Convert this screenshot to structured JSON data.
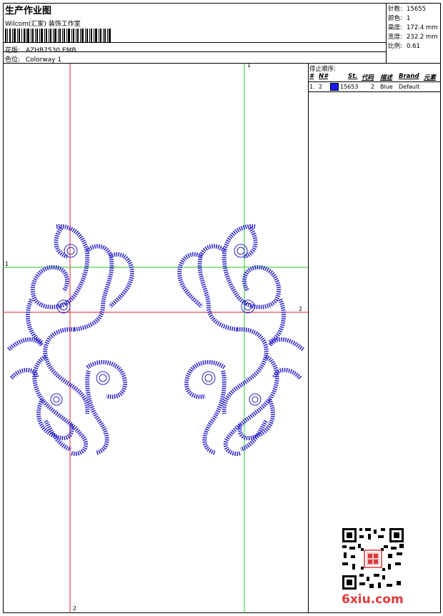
{
  "header": {
    "title": "生产作业图",
    "company": "Wilcom(汇家) 装饰工作室",
    "design_label": "花版:",
    "design_value": "AZHB7530.EMB",
    "colorway_label": "色位:",
    "colorway_value": "Colorway 1"
  },
  "stats": {
    "stitches_label": "针数:",
    "stitches_value": "15655",
    "colors_label": "颜色:",
    "colors_value": "1",
    "height_label": "高度:",
    "height_value": "172.4 mm",
    "width_label": "宽度:",
    "width_value": "232.2 mm",
    "scale_label": "比例:",
    "scale_value": "0.61"
  },
  "stop_sequence": {
    "title": "停止顺序:",
    "columns": [
      "#",
      "N#",
      "St.",
      "代码",
      "描述",
      "Brand",
      "元素"
    ],
    "rows": [
      {
        "index": "1.",
        "needle": "2",
        "stitches": "15653",
        "code": "2",
        "description": "Blue",
        "brand": "Default",
        "swatch_color": "#1a1aff"
      }
    ]
  },
  "guides": {
    "top_marker": "1",
    "left_marker": "1",
    "right_marker": "2",
    "bottom_marker": "2",
    "red_color": "#e8222a",
    "green_color": "#22cc22"
  },
  "watermark": {
    "site": "6xiu.com"
  },
  "icons": [
    "barcode-icon",
    "qr-code-icon",
    "seal-icon"
  ]
}
